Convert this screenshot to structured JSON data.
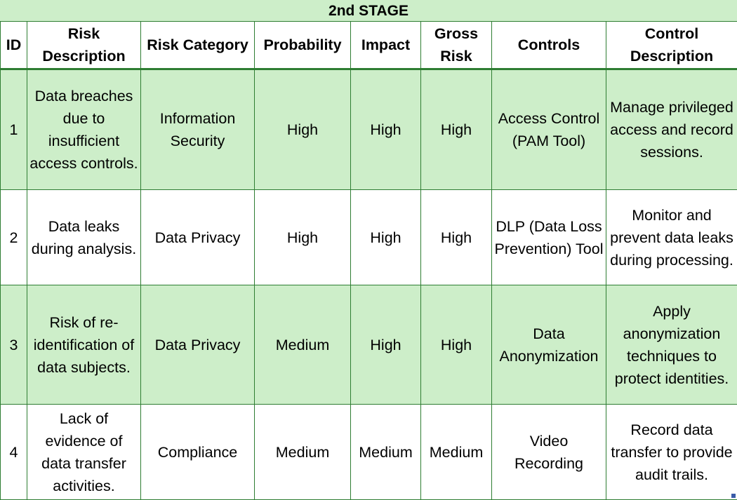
{
  "title": "2nd STAGE",
  "headers": [
    "ID",
    "Risk Description",
    "Risk Category",
    "Probability",
    "Impact",
    "Gross Risk",
    "Controls",
    "Control Description"
  ],
  "rows": [
    {
      "id": "1",
      "risk_description": "Data breaches due to insufficient access controls.",
      "risk_category": "Information Security",
      "probability": "High",
      "impact": "High",
      "gross_risk": "High",
      "controls": "Access Control (PAM Tool)",
      "control_description": "Manage privileged access and record sessions."
    },
    {
      "id": "2",
      "risk_description": "Data leaks during analysis.",
      "risk_category": "Data Privacy",
      "probability": "High",
      "impact": "High",
      "gross_risk": "High",
      "controls": "DLP (Data Loss Prevention) Tool",
      "control_description": "Monitor and prevent data leaks during processing."
    },
    {
      "id": "3",
      "risk_description": "Risk of re-identification of data subjects.",
      "risk_category": "Data Privacy",
      "probability": "Medium",
      "impact": "High",
      "gross_risk": "High",
      "controls": "Data Anonymization",
      "control_description": "Apply anonymization techniques to protect identities."
    },
    {
      "id": "4",
      "risk_description": "Lack of evidence of data transfer activities.",
      "risk_category": "Compliance",
      "probability": "Medium",
      "impact": "Medium",
      "gross_risk": "Medium",
      "controls": "Video Recording",
      "control_description": "Record data transfer to provide audit trails."
    }
  ],
  "colors": {
    "header_band": "#cdeec9",
    "shaded_row": "#cdeec9",
    "grid_line": "#2e7d32"
  }
}
